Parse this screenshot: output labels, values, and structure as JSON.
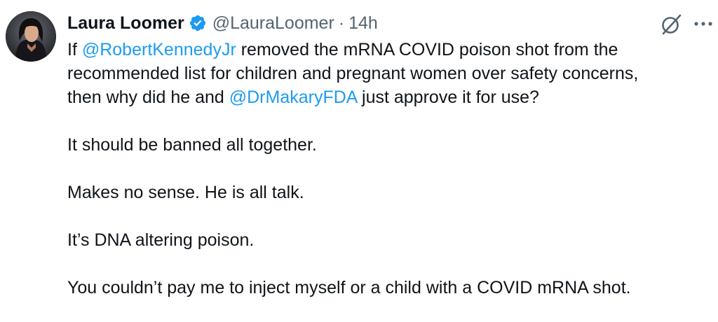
{
  "author": {
    "display_name": "Laura Loomer",
    "handle": "@LauraLoomer",
    "separator": "·",
    "time": "14h",
    "verified": true,
    "avatar_icon": "profile-photo",
    "verified_color": "#1d9bf0"
  },
  "icons": {
    "grok": "grok-icon",
    "more": "more-options-icon"
  },
  "tweet": {
    "l1_pre": "If ",
    "mention1": "@RobertKennedyJr",
    "l1_post": " removed the mRNA COVID poison shot from the",
    "l2": "recommended list for children and pregnant women over safety concerns,",
    "l3_pre": "then why did he and ",
    "mention2": "@DrMakaryFDA",
    "l3_post": " just approve it for use?",
    "p2": "It should be banned all together.",
    "p3": "Makes no sense. He is all talk.",
    "p4": "It’s DNA altering poison.",
    "p5": "You couldn’t pay me to inject myself or a child with a COVID mRNA shot."
  },
  "colors": {
    "text": "#0f1419",
    "secondary": "#536471",
    "link": "#1d9bf0"
  }
}
